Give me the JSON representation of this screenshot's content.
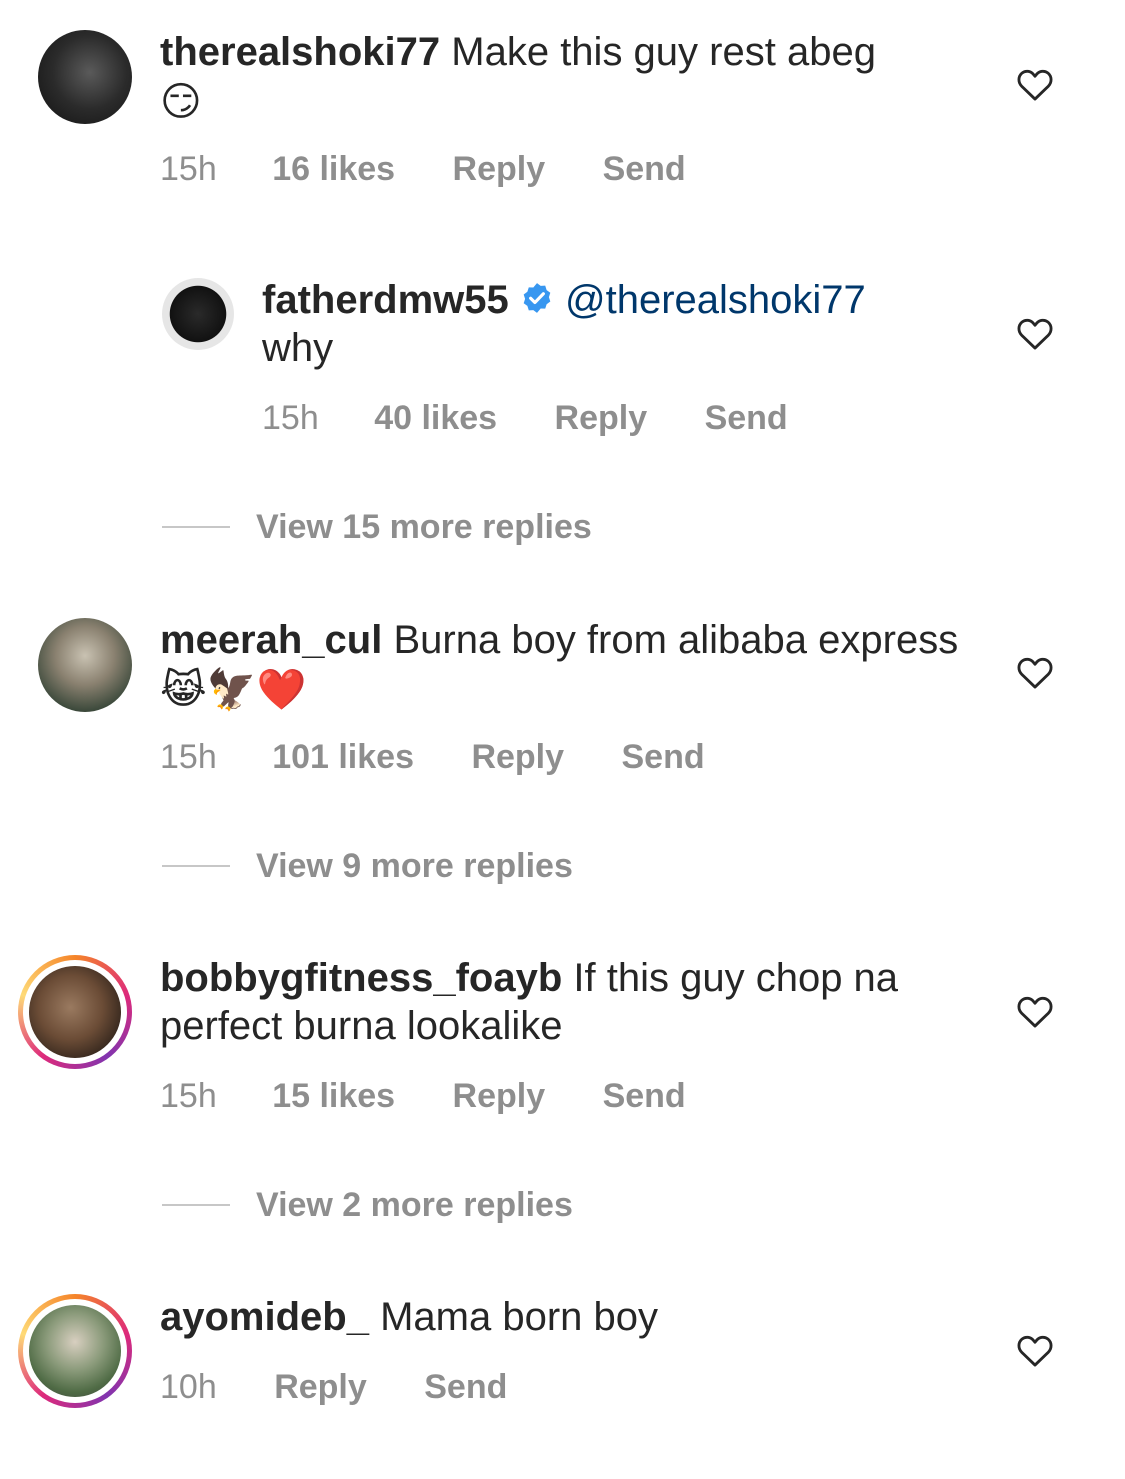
{
  "comments": [
    {
      "username": "therealshoki77",
      "text": "Make this guy rest abeg",
      "emoji": "😏",
      "time": "15h",
      "likes": "16 likes",
      "reply": "Reply",
      "send": "Send"
    },
    {
      "username": "fatherdmw55",
      "mention": "@therealshoki77",
      "text": "why",
      "time": "15h",
      "likes": "40 likes",
      "reply": "Reply",
      "send": "Send"
    },
    {
      "username": "meerah_cul",
      "text": "Burna boy from alibaba express",
      "emoji": "😹🦅❤️",
      "time": "15h",
      "likes": "101 likes",
      "reply": "Reply",
      "send": "Send"
    },
    {
      "username": "bobbygfitness_foayb",
      "text": "If this guy chop na perfect burna lookalike",
      "time": "15h",
      "likes": "15 likes",
      "reply": "Reply",
      "send": "Send"
    },
    {
      "username": "ayomideb_",
      "text": "Mama born boy",
      "time": "10h",
      "reply": "Reply",
      "send": "Send"
    }
  ],
  "view_more": [
    "View 15 more replies",
    "View 9 more replies",
    "View 2 more replies"
  ],
  "colors": {
    "text": "#262626",
    "meta": "#8e8e8e",
    "mention": "#00376b",
    "verified": "#3897f0"
  },
  "icons": {
    "heart": "heart-outline-icon",
    "verified": "verified-badge-icon"
  }
}
